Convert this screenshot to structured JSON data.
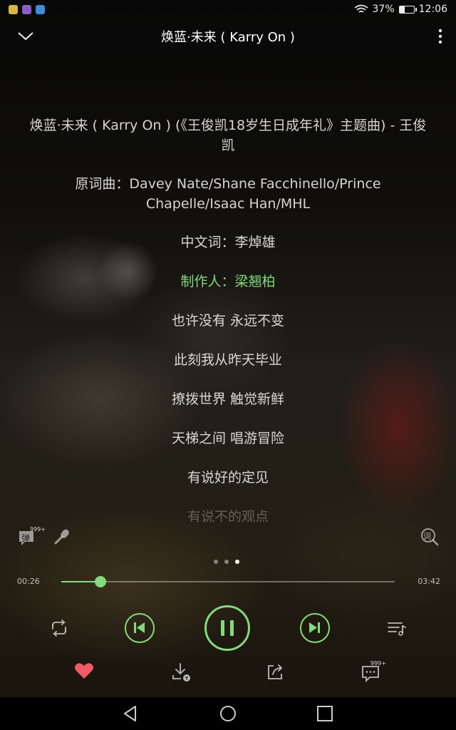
{
  "status": {
    "battery_text": "37%",
    "battery_level": 0.37,
    "time": "12:06"
  },
  "header": {
    "title": "焕蓝·未来 ( Karry On )"
  },
  "lyrics": [
    {
      "text": "焕蓝·未来 ( Karry On ) (《王俊凯18岁生日成年礼》主题曲) - 王俊凯",
      "active": false
    },
    {
      "text": "原词曲：Davey Nate/Shane Facchinello/Prince Chapelle/Isaac Han/MHL",
      "active": false
    },
    {
      "text": "中文词：李焯雄",
      "active": false
    },
    {
      "text": "制作人：梁翘柏",
      "active": true
    },
    {
      "text": "也许没有 永远不变",
      "active": false
    },
    {
      "text": "此刻我从昨天毕业",
      "active": false
    },
    {
      "text": "撩拨世界 触觉新鲜",
      "active": false
    },
    {
      "text": "天梯之间 唱游冒险",
      "active": false
    },
    {
      "text": "有说好的定见",
      "active": false
    },
    {
      "text": "有说不的观点",
      "active": false
    }
  ],
  "mini_toolbar": {
    "danmu_label": "弹",
    "danmu_count": "999+",
    "ci_label": "词"
  },
  "pager": {
    "count": 3,
    "current": 2
  },
  "playback": {
    "current_time": "00:26",
    "total_time": "03:42",
    "progress": 0.117
  },
  "actions": {
    "comment_count": "999+"
  },
  "colors": {
    "accent": "#84d97c",
    "heart": "#f05a64"
  }
}
